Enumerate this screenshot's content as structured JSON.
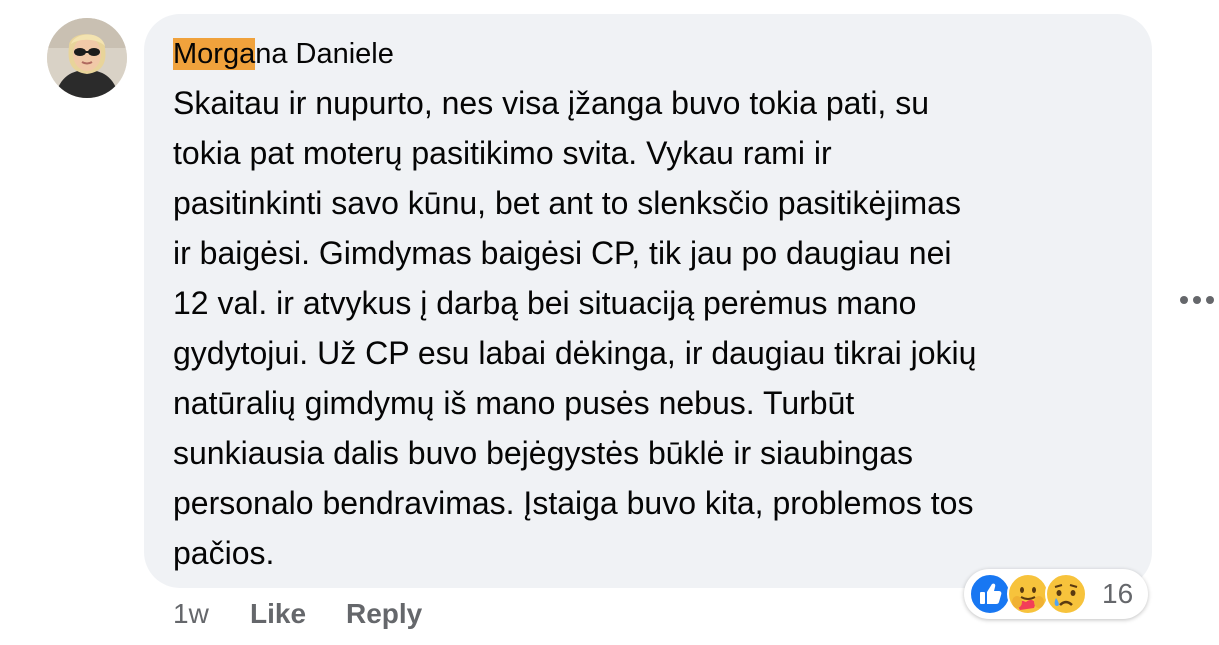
{
  "comment": {
    "author": "Morgana Daniele",
    "author_highlight": "Morga",
    "author_rest": "na Daniele",
    "lines": [
      "Skaitau ir nupurto, nes visa įžanga buvo tokia pati, su",
      "tokia pat moterų pasitikimo svita. Vykau rami ir",
      "pasitinkinti savo kūnu, bet ant to slenksčio pasitikėjimas",
      "ir baigėsi. Gimdymas baigėsi CP, tik jau po daugiau nei",
      "12 val. ir atvykus į darbą bei situaciją perėmus mano",
      "gydytojui. Už CP esu labai dėkinga, ir daugiau tikrai jokių",
      "natūralių gimdymų iš mano pusės nebus. Turbūt",
      "sunkiausia dalis buvo bejėgystės būklė ir siaubingas",
      "personalo bendravimas. Įstaiga buvo kita, problemos tos",
      "pačios."
    ],
    "timestamp": "1w",
    "like_label": "Like",
    "reply_label": "Reply",
    "reactions": {
      "icons": [
        "like-reaction-icon",
        "care-reaction-icon",
        "sad-reaction-icon"
      ],
      "count": "16"
    },
    "more_icon": "more-options-icon"
  },
  "colors": {
    "bubble": "#f0f2f5",
    "text": "#050505",
    "secondary": "#65676b",
    "highlight": "#f0a23c",
    "like_blue": "#1877f2"
  }
}
